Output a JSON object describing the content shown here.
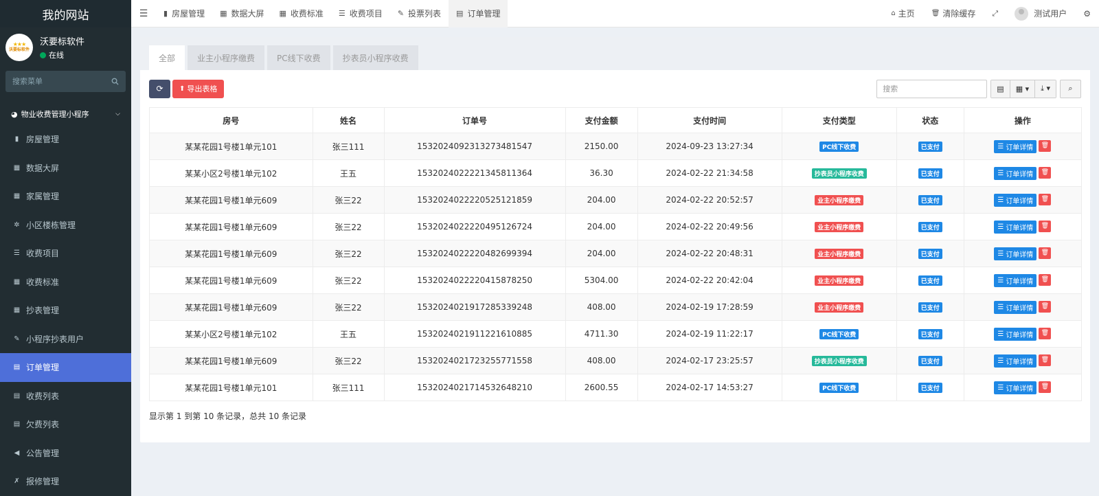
{
  "site": {
    "title": "我的网站"
  },
  "user_panel": {
    "name": "沃要标软件",
    "status": "在线",
    "avatar_text": "沃要标软件"
  },
  "sidebar": {
    "search_placeholder": "搜索菜单",
    "section": "物业收费管理小程序",
    "items": [
      {
        "label": "房屋管理",
        "icon": "building-icon"
      },
      {
        "label": "数据大屏",
        "icon": "grid-icon"
      },
      {
        "label": "家属管理",
        "icon": "grid-icon"
      },
      {
        "label": "小区楼栋管理",
        "icon": "gear-icon"
      },
      {
        "label": "收费项目",
        "icon": "list-icon"
      },
      {
        "label": "收费标准",
        "icon": "grid-icon"
      },
      {
        "label": "抄表管理",
        "icon": "grid-icon"
      },
      {
        "label": "小程序抄表用户",
        "icon": "edit-icon"
      },
      {
        "label": "订单管理",
        "icon": "list-alt-icon",
        "active": true
      },
      {
        "label": "收费列表",
        "icon": "list-alt-icon"
      },
      {
        "label": "欠费列表",
        "icon": "list-alt-icon"
      },
      {
        "label": "公告管理",
        "icon": "bullhorn-icon"
      },
      {
        "label": "报修管理",
        "icon": "wrench-icon"
      }
    ]
  },
  "topnav": {
    "tabs": [
      {
        "label": "房屋管理",
        "icon": "building-icon"
      },
      {
        "label": "数据大屏",
        "icon": "grid-icon"
      },
      {
        "label": "收费标准",
        "icon": "grid-icon"
      },
      {
        "label": "收费项目",
        "icon": "list-icon"
      },
      {
        "label": "投票列表",
        "icon": "edit-icon"
      },
      {
        "label": "订单管理",
        "icon": "list-alt-icon",
        "active": true
      }
    ],
    "home": "主页",
    "clear_cache": "清除缓存",
    "username": "测试用户"
  },
  "subtabs": [
    "全部",
    "业主小程序缴费",
    "PC线下收费",
    "抄表员小程序收费"
  ],
  "toolbar": {
    "export_label": "导出表格",
    "search_placeholder": "搜索"
  },
  "table": {
    "columns": [
      "房号",
      "姓名",
      "订单号",
      "支付金额",
      "支付时间",
      "支付类型",
      "状态",
      "操作"
    ],
    "detail_label": "订单详情",
    "rows": [
      {
        "room": "某某花园1号楼1单元101",
        "name": "张三111",
        "order": "15320240923132734815​47",
        "amount": "2150.00",
        "time": "2024-09-23 13:27:34",
        "type": "PC线下收费",
        "type_color": "#1e88e5",
        "status": "已支付"
      },
      {
        "room": "某某小区2号楼1单元102",
        "name": "王五",
        "order": "1532024022221345811364",
        "amount": "36.30",
        "time": "2024-02-22 21:34:58",
        "type": "抄表员小程序收费",
        "type_color": "#26b99a",
        "status": "已支付"
      },
      {
        "room": "某某花园1号楼1单元609",
        "name": "张三22",
        "order": "1532024022220525121859",
        "amount": "204.00",
        "time": "2024-02-22 20:52:57",
        "type": "业主小程序缴费",
        "type_color": "#f05050",
        "status": "已支付"
      },
      {
        "room": "某某花园1号楼1单元609",
        "name": "张三22",
        "order": "1532024022220495126724",
        "amount": "204.00",
        "time": "2024-02-22 20:49:56",
        "type": "业主小程序缴费",
        "type_color": "#f05050",
        "status": "已支付"
      },
      {
        "room": "某某花园1号楼1单元609",
        "name": "张三22",
        "order": "1532024022220482699394",
        "amount": "204.00",
        "time": "2024-02-22 20:48:31",
        "type": "业主小程序缴费",
        "type_color": "#f05050",
        "status": "已支付"
      },
      {
        "room": "某某花园1号楼1单元609",
        "name": "张三22",
        "order": "1532024022220415878250",
        "amount": "5304.00",
        "time": "2024-02-22 20:42:04",
        "type": "业主小程序缴费",
        "type_color": "#f05050",
        "status": "已支付"
      },
      {
        "room": "某某花园1号楼1单元609",
        "name": "张三22",
        "order": "1532024021917285339248",
        "amount": "408.00",
        "time": "2024-02-19 17:28:59",
        "type": "业主小程序缴费",
        "type_color": "#f05050",
        "status": "已支付"
      },
      {
        "room": "某某小区2号楼1单元102",
        "name": "王五",
        "order": "1532024021911221610885",
        "amount": "4711.30",
        "time": "2024-02-19 11:22:17",
        "type": "PC线下收费",
        "type_color": "#1e88e5",
        "status": "已支付"
      },
      {
        "room": "某某花园1号楼1单元609",
        "name": "张三22",
        "order": "1532024021723255771558",
        "amount": "408.00",
        "time": "2024-02-17 23:25:57",
        "type": "抄表员小程序收费",
        "type_color": "#26b99a",
        "status": "已支付"
      },
      {
        "room": "某某花园1号楼1单元101",
        "name": "张三111",
        "order": "1532024021714532648210",
        "amount": "2600.55",
        "time": "2024-02-17 14:53:27",
        "type": "PC线下收费",
        "type_color": "#1e88e5",
        "status": "已支付"
      }
    ]
  },
  "pager": {
    "info": "显示第 1 到第 10 条记录，总共 10 条记录"
  },
  "colors": {
    "sidebar_bg": "#222d32",
    "active_menu": "#4e6fd9",
    "status_blue": "#1e88e5",
    "danger": "#f05050",
    "success": "#26b99a"
  }
}
